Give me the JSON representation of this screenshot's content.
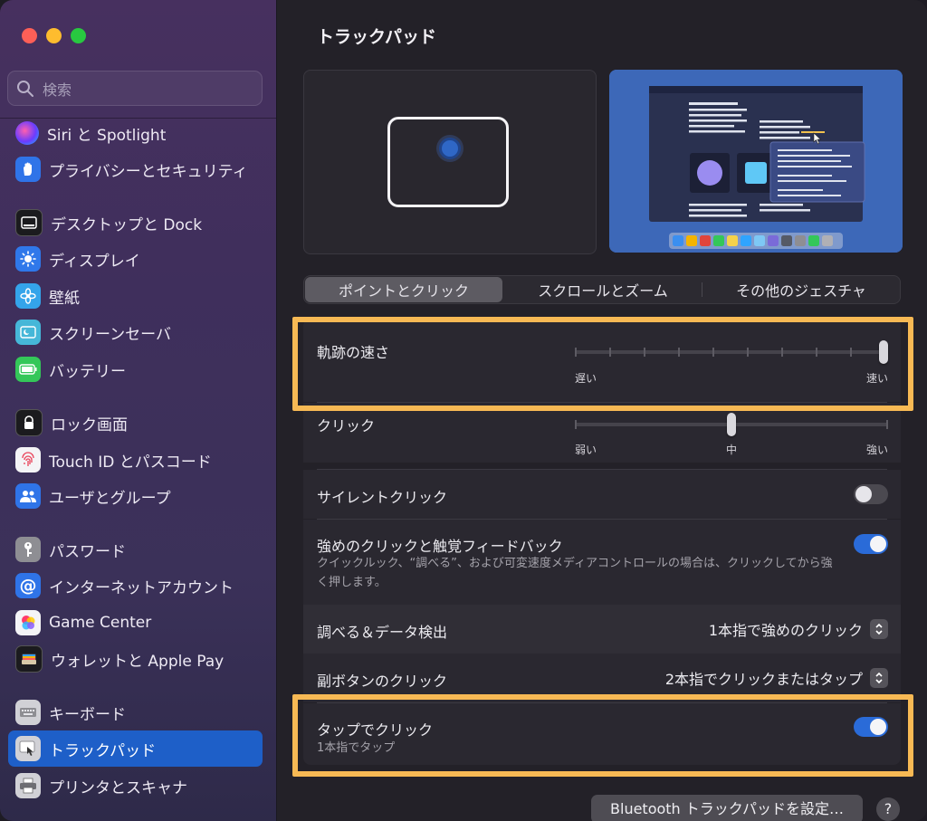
{
  "window": {
    "title": "トラックパッド"
  },
  "search": {
    "placeholder": "検索"
  },
  "sidebar": {
    "items": [
      {
        "label": "Siri と Spotlight",
        "icon": "siri-icon"
      },
      {
        "label": "プライバシーとセキュリティ",
        "icon": "hand-icon"
      },
      {
        "label": "デスクトップと Dock",
        "icon": "dock-icon"
      },
      {
        "label": "ディスプレイ",
        "icon": "sun-icon"
      },
      {
        "label": "壁紙",
        "icon": "flower-icon"
      },
      {
        "label": "スクリーンセーバ",
        "icon": "screensaver-icon"
      },
      {
        "label": "バッテリー",
        "icon": "battery-icon"
      },
      {
        "label": "ロック画面",
        "icon": "lock-icon"
      },
      {
        "label": "Touch ID とパスコード",
        "icon": "fingerprint-icon"
      },
      {
        "label": "ユーザとグループ",
        "icon": "users-icon"
      },
      {
        "label": "パスワード",
        "icon": "key-icon"
      },
      {
        "label": "インターネットアカウント",
        "icon": "at-icon"
      },
      {
        "label": "Game Center",
        "icon": "game-center-icon"
      },
      {
        "label": "ウォレットと Apple Pay",
        "icon": "wallet-icon"
      },
      {
        "label": "キーボード",
        "icon": "keyboard-icon"
      },
      {
        "label": "トラックパッド",
        "icon": "trackpad-icon",
        "selected": true
      },
      {
        "label": "プリンタとスキャナ",
        "icon": "printer-icon"
      }
    ]
  },
  "tabs": [
    {
      "label": "ポイントとクリック",
      "selected": true
    },
    {
      "label": "スクロールとズーム"
    },
    {
      "label": "その他のジェスチャ"
    }
  ],
  "settings": {
    "tracking_speed": {
      "label": "軌跡の速さ",
      "min_label": "遅い",
      "max_label": "速い",
      "value": 1.0
    },
    "click": {
      "label": "クリック",
      "min_label": "弱い",
      "mid_label": "中",
      "max_label": "強い",
      "value": 0.5
    },
    "silent_click": {
      "label": "サイレントクリック",
      "enabled": false
    },
    "force_click": {
      "label": "強めのクリックと触覚フィードバック",
      "description": "クイックルック、“調べる”、および可変速度メディアコントロールの場合は、クリックしてから強く押します。",
      "enabled": true
    },
    "lookup": {
      "label": "調べる＆データ検出",
      "value": "1本指で強めのクリック"
    },
    "secondary_click": {
      "label": "副ボタンのクリック",
      "value": "2本指でクリックまたはタップ"
    },
    "tap_to_click": {
      "label": "タップでクリック",
      "description": "1本指でタップ",
      "enabled": true
    }
  },
  "footer": {
    "bluetooth_button": "Bluetooth トラックパッドを設定…",
    "help": "?"
  },
  "colors": {
    "accent": "#1e5fc8",
    "highlight": "#f7b954",
    "toggle_on": "#2a6bd8"
  }
}
